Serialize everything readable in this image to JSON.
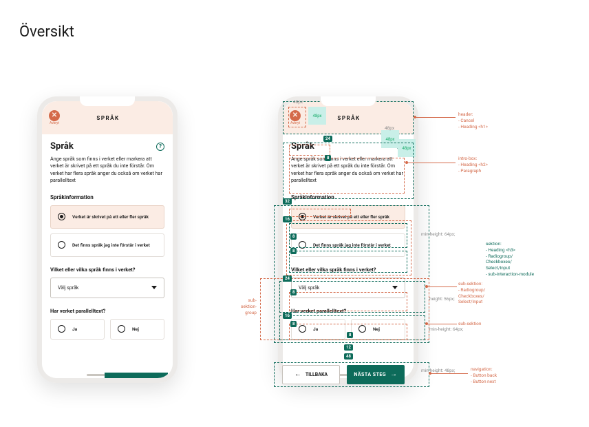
{
  "page_title": "Översikt",
  "header": {
    "cancel_label": "Avbryt",
    "title": "SPRÅK"
  },
  "intro": {
    "heading": "Språk",
    "paragraph": "Ange språk som finns i verket eller markera att verket är skrivet på ett språk du inte förstår. Om verket har flera språk anger du också om verket har parallelltext"
  },
  "section": {
    "heading": "Språkinformation",
    "options": [
      "Verket är skrivet på ett eller fler språk",
      "Det finns språk jag inte förstår i verket"
    ]
  },
  "sub1": {
    "question": "Vilket eller vilka språk finns i verket?",
    "select_placeholder": "Välj språk"
  },
  "sub2": {
    "question": "Har verket parallelltext?",
    "yes": "Ja",
    "no": "Nej"
  },
  "diagram": {
    "px48": "48px",
    "spacer24": "24",
    "spacer32": "32",
    "spacer16": "16",
    "spacer8": "8",
    "spacer12": "12",
    "spacer48": "48",
    "minh64": "min-height: 64px;",
    "h56": "height: 56px;",
    "minh48": "min-height: 48px;"
  },
  "annotations": {
    "header": "header:\n- Cancel\n- Heading <h1>",
    "intro": "intro-box:\n- Heading <h2>\n- Paragraph",
    "sektion": "sektion:\n- Heading <h3>\n- Radiogroup/\nCheckboxes/\nSelect/Input\n- sub-interaction-module",
    "sub_group": "sub-\nsektion-\ngroup",
    "sub1": "sub-sektion:\n- Radiogroup/\nCheckboxes/\nSelect/Input",
    "sub2": "sub-sektion",
    "nav": "navigation:\n- Button back\n- Button next"
  },
  "nav": {
    "back": "TILLBAKA",
    "next": "NÄSTA STEG"
  }
}
